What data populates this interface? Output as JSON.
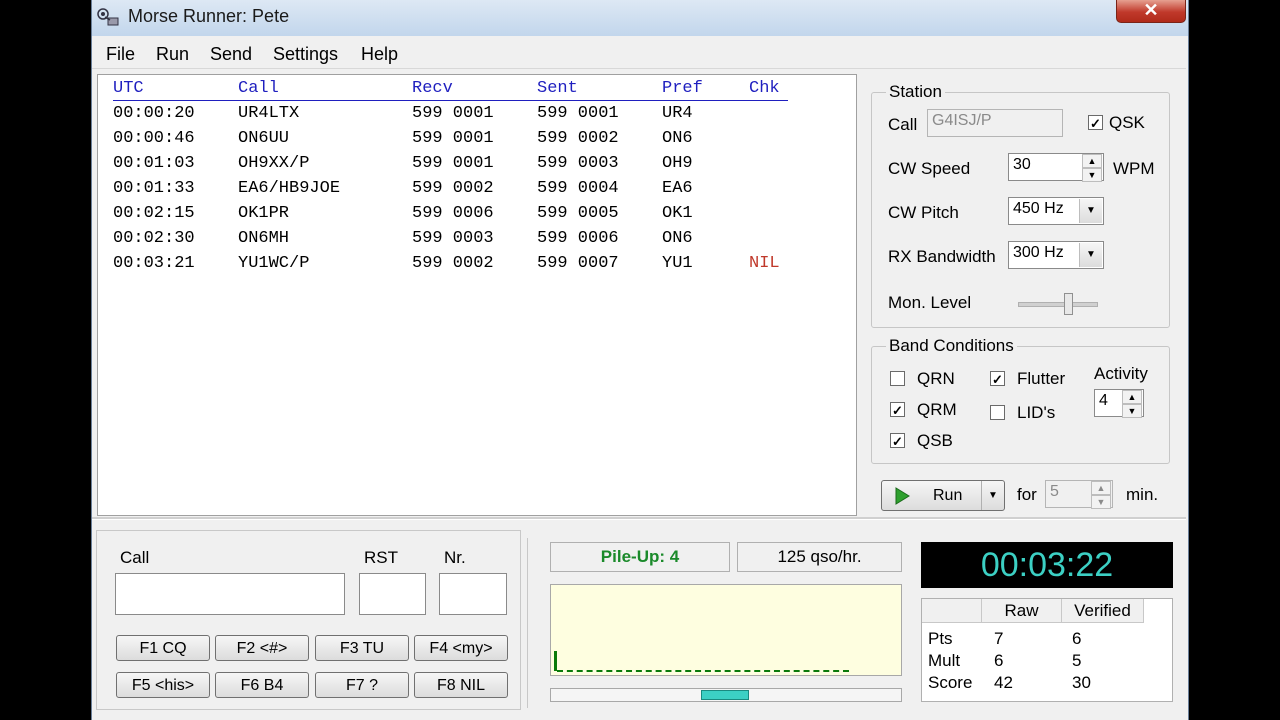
{
  "window": {
    "title": "Morse Runner:  Pete",
    "close": "✕"
  },
  "menu": [
    "File",
    "Run",
    "Send",
    "Settings",
    "Help"
  ],
  "log": {
    "headers": [
      "UTC",
      "Call",
      "Recv",
      "Sent",
      "Pref",
      "Chk"
    ],
    "rows": [
      [
        "00:00:20",
        "UR4LTX",
        "599 0001",
        "599 0001",
        "UR4",
        ""
      ],
      [
        "00:00:46",
        "ON6UU",
        "599 0001",
        "599 0002",
        "ON6",
        ""
      ],
      [
        "00:01:03",
        "OH9XX/P",
        "599 0001",
        "599 0003",
        "OH9",
        ""
      ],
      [
        "00:01:33",
        "EA6/HB9JOE",
        "599 0002",
        "599 0004",
        "EA6",
        ""
      ],
      [
        "00:02:15",
        "OK1PR",
        "599 0006",
        "599 0005",
        "OK1",
        ""
      ],
      [
        "00:02:30",
        "ON6MH",
        "599 0003",
        "599 0006",
        "ON6",
        ""
      ],
      [
        "00:03:21",
        "YU1WC/P",
        "599 0002",
        "599 0007",
        "YU1",
        "NIL"
      ]
    ]
  },
  "station": {
    "legend": "Station",
    "call_label": "Call",
    "call_value": "G4ISJ/P",
    "qsk_label": "QSK",
    "qsk_checked": true,
    "cw_speed_label": "CW Speed",
    "cw_speed_value": "30",
    "wpm_label": "WPM",
    "cw_pitch_label": "CW Pitch",
    "cw_pitch_value": "450 Hz",
    "rx_bw_label": "RX Bandwidth",
    "rx_bw_value": "300 Hz",
    "mon_level_label": "Mon. Level",
    "mon_level": 0.65
  },
  "band": {
    "legend": "Band Conditions",
    "qrn": {
      "label": "QRN",
      "checked": false
    },
    "qrm": {
      "label": "QRM",
      "checked": true
    },
    "qsb": {
      "label": "QSB",
      "checked": true
    },
    "flutter": {
      "label": "Flutter",
      "checked": true
    },
    "lids": {
      "label": "LID's",
      "checked": false
    },
    "activity_label": "Activity",
    "activity_value": "4"
  },
  "run": {
    "label": "Run",
    "for_label": "for",
    "minutes": "5",
    "min_label": "min."
  },
  "entry": {
    "call_label": "Call",
    "rst_label": "RST",
    "nr_label": "Nr.",
    "call_value": "",
    "rst_value": "",
    "nr_value": ""
  },
  "fkeys": [
    "F1  CQ",
    "F2  <#>",
    "F3  TU",
    "F4  <my>",
    "F5  <his>",
    "F6  B4",
    "F7  ?",
    "F8  NIL"
  ],
  "status": {
    "pileup": "Pile-Up:  4",
    "rate": "125  qso/hr.",
    "clock": "00:03:22"
  },
  "score": {
    "headers": [
      "",
      "Raw",
      "Verified"
    ],
    "rows": [
      [
        "Pts",
        "7",
        "6"
      ],
      [
        "Mult",
        "6",
        "5"
      ],
      [
        "Score",
        "42",
        "30"
      ]
    ]
  },
  "colors": {
    "log_header": "#1f1fbf",
    "nil": "#c0392b",
    "clock_text": "#3cd0c4",
    "pileup_text": "#1a8a2a",
    "scope_bg": "#fefee0"
  }
}
